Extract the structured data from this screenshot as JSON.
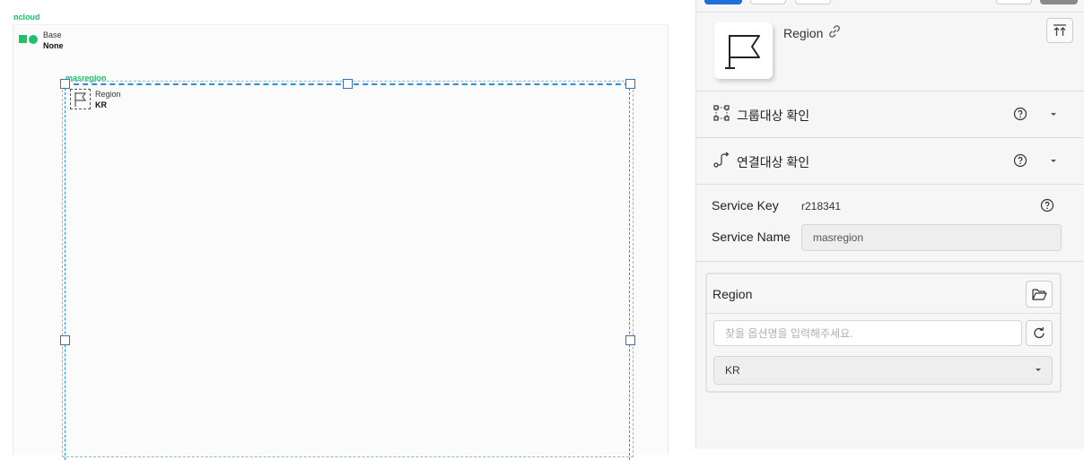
{
  "canvas": {
    "cloud_label": "ncloud",
    "base": {
      "type": "Base",
      "value": "None"
    },
    "region_group": {
      "label": "masregion",
      "inner": {
        "type": "Region",
        "value": "KR"
      }
    }
  },
  "panel": {
    "resource_title": "Region",
    "resource_icon": "flag-icon",
    "accordions": [
      {
        "label": "그룹대상 확인",
        "icon": "group-select-icon"
      },
      {
        "label": "연결대상 확인",
        "icon": "connection-icon"
      }
    ],
    "fields": {
      "service_key_label": "Service Key",
      "service_key_value": "r218341",
      "service_name_label": "Service Name",
      "service_name_value": "masregion"
    },
    "region_card": {
      "title": "Region",
      "search_placeholder": "찾을 옵션명을 입력해주세요.",
      "selected_option": "KR"
    }
  },
  "colors": {
    "brand_green": "#1fc26b",
    "selection_blue": "#2d8fd5",
    "handle_blue": "#3b6fb0",
    "primary_button": "#1e6fd9"
  }
}
